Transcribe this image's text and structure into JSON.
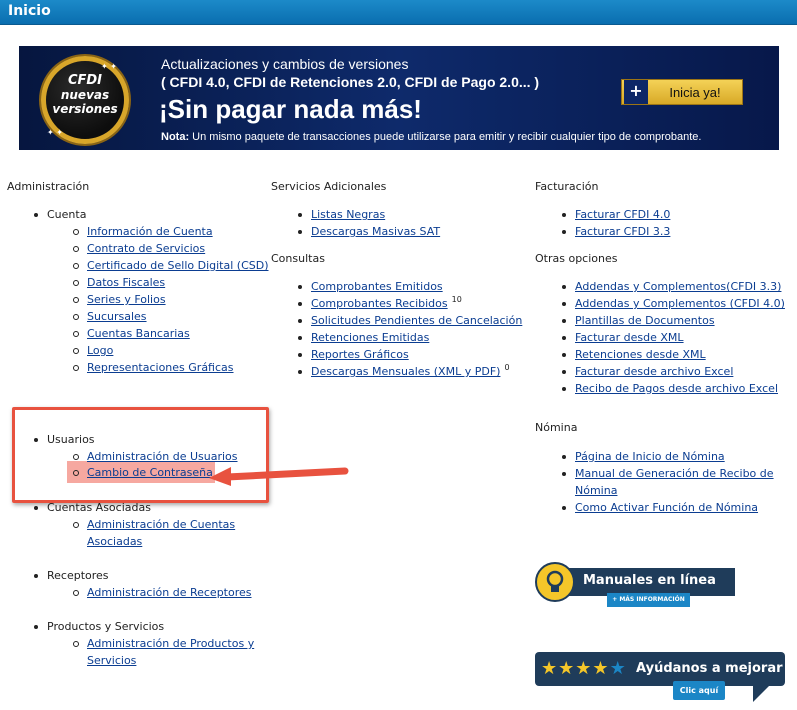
{
  "header": {
    "title": "Inicio"
  },
  "banner": {
    "badge_line1": "CFDI",
    "badge_line2": "nuevas",
    "badge_line3": "versiones",
    "line1": "Actualizaciones y cambios de versiones",
    "line2": "( CFDI 4.0, CFDI de Retenciones 2.0, CFDI de Pago 2.0... )",
    "headline": "¡Sin pagar nada más!",
    "note_label": "Nota:",
    "note_text": " Un mismo paquete de transacciones puede utilizarse para emitir y recibir cualquier tipo de comprobante.",
    "cta_plus": "+",
    "cta_label": "Inicia ya!"
  },
  "admin": {
    "title": "Administración",
    "cuenta": {
      "label": "Cuenta",
      "items": [
        "Información de Cuenta",
        "Contrato de Servicios",
        "Certificado de Sello Digital (CSD)",
        "Datos Fiscales",
        "Series y Folios",
        "Sucursales",
        "Cuentas Bancarias",
        "Logo",
        "Representaciones Gráficas"
      ]
    },
    "usuarios": {
      "label": "Usuarios",
      "items": [
        "Administración de Usuarios",
        "Cambio de Contraseña"
      ]
    },
    "cuentas_asociadas": {
      "label": "Cuentas Asociadas",
      "item_line1": "Administración de Cuentas",
      "item_line2": "Asociadas"
    },
    "receptores": {
      "label": "Receptores",
      "items": [
        "Administración de Receptores"
      ]
    },
    "productos": {
      "label": "Productos y Servicios",
      "item_line1": "Administración de Productos y",
      "item_line2": "Servicios"
    }
  },
  "servicios": {
    "title": "Servicios Adicionales",
    "items": [
      "Listas Negras",
      "Descargas Masivas SAT"
    ]
  },
  "consultas": {
    "title": "Consultas",
    "items": [
      "Comprobantes Emitidos",
      "Comprobantes Recibidos",
      "Solicitudes Pendientes de Cancelación",
      "Retenciones Emitidas",
      "Reportes Gráficos",
      "Descargas Mensuales (XML y PDF)"
    ],
    "recibidos_count": "10",
    "descargas_count": "0"
  },
  "facturacion": {
    "title": "Facturación",
    "items": [
      "Facturar CFDI 4.0",
      "Facturar CFDI 3.3"
    ]
  },
  "otras": {
    "title": "Otras opciones",
    "items": [
      "Addendas y Complementos(CFDI 3.3)",
      "Addendas y Complementos (CFDI 4.0)",
      "Plantillas de Documentos",
      "Facturar desde XML",
      "Retenciones desde XML",
      "Facturar desde archivo Excel",
      "Recibo de Pagos desde archivo Excel"
    ]
  },
  "nomina": {
    "title": "Nómina",
    "item1": "Página de Inicio de Nómina",
    "item2_line1": "Manual de Generación de Recibo de",
    "item2_line2": "Nómina",
    "item3": "Como Activar Función de Nómina"
  },
  "manuales": {
    "label": "Manuales en línea",
    "more": "+ MÁS INFORMACIÓN",
    "icon": "lightbulb-icon"
  },
  "ayudanos": {
    "label": "Ayúdanos a mejorar",
    "button": "Clic aquí",
    "rating": 4,
    "rating_max": 5
  },
  "colors": {
    "header": "#0a6eaf",
    "link": "#0b3d91",
    "highlight": "#e8523f",
    "banner_bg": "#0e2a6b",
    "gold": "#f4c629"
  }
}
